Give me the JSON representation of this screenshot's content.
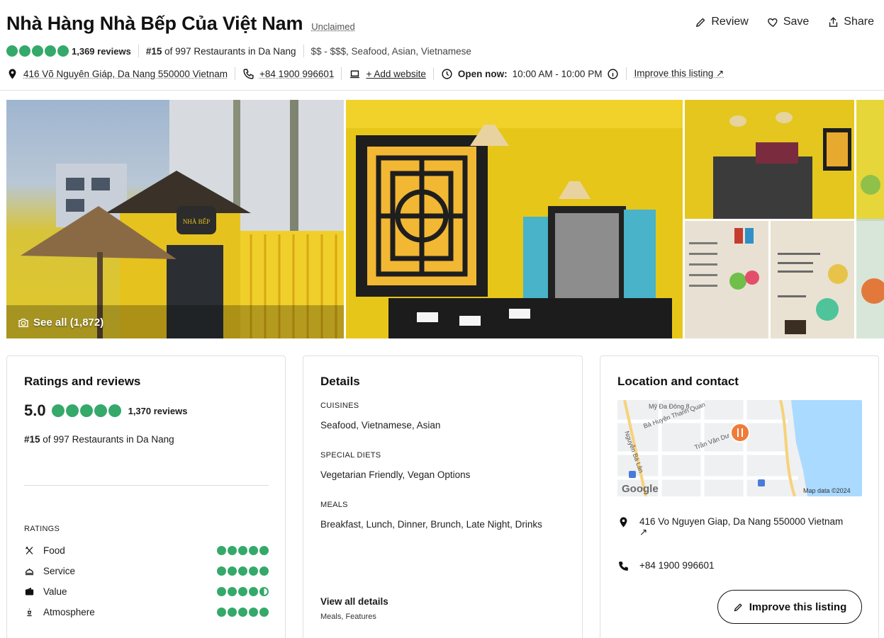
{
  "header": {
    "title": "Nhà Hàng Nhà Bếp Của Việt Nam",
    "unclaimed": "Unclaimed",
    "actions": {
      "review": "Review",
      "save": "Save",
      "share": "Share"
    },
    "rating_bubbles": 5,
    "reviews_count": "1,369 reviews",
    "rank_number": "#15",
    "rank_text": " of 997 Restaurants in Da Nang",
    "price_cuisines": "$$ - $$$, Seafood, Asian, Vietnamese",
    "address": "416 Võ Nguyên Giáp, Da Nang 550000 Vietnam",
    "phone": "+84 1900 996601",
    "add_website": "+ Add website",
    "open_now_label": "Open now:",
    "hours": "10:00 AM - 10:00 PM",
    "improve_listing": "Improve this listing ↗"
  },
  "photos": {
    "see_all": "See all (1,872)",
    "sign_text": "NHÀ BẾP"
  },
  "ratings_card": {
    "title": "Ratings and reviews",
    "score": "5.0",
    "reviews_count": "1,370 reviews",
    "rank_number": "#15",
    "rank_text": " of 997 Restaurants in Da Nang",
    "ratings_label": "RATINGS",
    "items": [
      {
        "label": "Food",
        "value": 5.0,
        "icon": "utensils-icon"
      },
      {
        "label": "Service",
        "value": 5.0,
        "icon": "cloche-icon"
      },
      {
        "label": "Value",
        "value": 4.5,
        "icon": "wallet-icon"
      },
      {
        "label": "Atmosphere",
        "value": 5.0,
        "icon": "cocktail-icon"
      }
    ]
  },
  "details_card": {
    "title": "Details",
    "cuisines_label": "CUISINES",
    "cuisines": "Seafood, Vietnamese, Asian",
    "diets_label": "SPECIAL DIETS",
    "diets": "Vegetarian Friendly, Vegan Options",
    "meals_label": "MEALS",
    "meals": "Breakfast, Lunch, Dinner, Brunch, Late Night, Drinks",
    "view_all": "View all details",
    "view_sub": "Meals, Features"
  },
  "location_card": {
    "title": "Location and contact",
    "map_labels": [
      "Mỹ Đa Đông 8",
      "Bà Huyện Thanh Quan",
      "Nguyễn Bá Lân",
      "Trần Văn Dư"
    ],
    "map_attribution": "Map data ©2024",
    "google": "Google",
    "address": "416 Vo Nguyen Giap, Da Nang 550000 Vietnam",
    "address_arrow": "↗",
    "phone": "+84 1900 996601",
    "improve_button": "Improve this listing"
  },
  "colors": {
    "bubble_green": "#34a96a",
    "map_water": "#aadaff",
    "pin_orange": "#f07c3a"
  }
}
